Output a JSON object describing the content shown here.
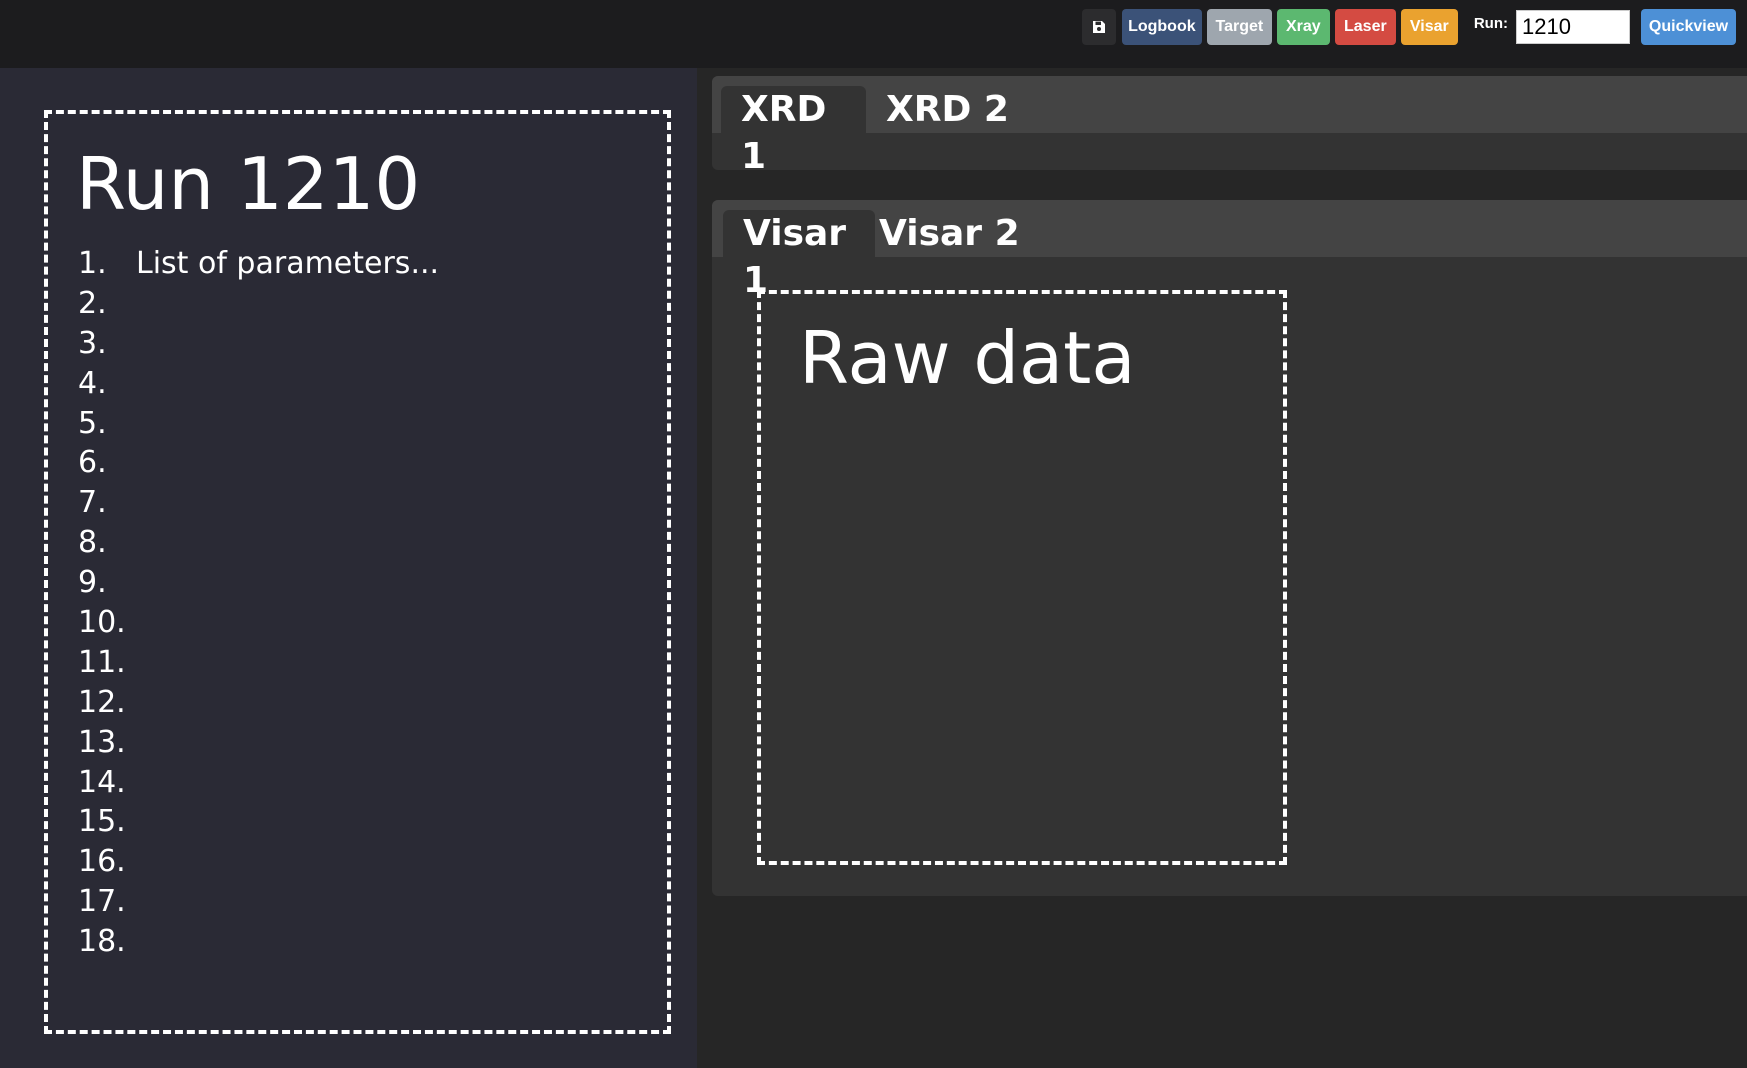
{
  "toolbar": {
    "save_icon": "floppy-disk-icon",
    "logbook_label": "Logbook",
    "target_label": "Target",
    "xray_label": "Xray",
    "laser_label": "Laser",
    "visar_label": "Visar",
    "run_label": "Run:",
    "run_value": "1210",
    "quickview_label": "Quickview",
    "colors": {
      "logbook": "#3b5278",
      "target": "#9ea6ae",
      "xray": "#5cb870",
      "laser": "#d44b42",
      "visar": "#eaa22f",
      "quickview": "#4d90d6"
    }
  },
  "run_panel": {
    "title": "Run 1210",
    "parameters": [
      {
        "number": "1.",
        "text": "List of parameters..."
      },
      {
        "number": "2.",
        "text": ""
      },
      {
        "number": "3.",
        "text": ""
      },
      {
        "number": "4.",
        "text": ""
      },
      {
        "number": "5.",
        "text": ""
      },
      {
        "number": "6.",
        "text": ""
      },
      {
        "number": "7.",
        "text": ""
      },
      {
        "number": "8.",
        "text": ""
      },
      {
        "number": "9.",
        "text": ""
      },
      {
        "number": "10.",
        "text": ""
      },
      {
        "number": "11.",
        "text": ""
      },
      {
        "number": "12.",
        "text": ""
      },
      {
        "number": "13.",
        "text": ""
      },
      {
        "number": "14.",
        "text": ""
      },
      {
        "number": "15.",
        "text": ""
      },
      {
        "number": "16.",
        "text": ""
      },
      {
        "number": "17.",
        "text": ""
      },
      {
        "number": "18.",
        "text": ""
      }
    ]
  },
  "xrd_panel": {
    "tabs": [
      {
        "label": "XRD 1",
        "active": true
      },
      {
        "label": "XRD 2",
        "active": false
      }
    ]
  },
  "visar_panel": {
    "tabs": [
      {
        "label": "Visar 1",
        "active": true
      },
      {
        "label": "Visar 2",
        "active": false
      }
    ],
    "content_title": "Raw data"
  }
}
